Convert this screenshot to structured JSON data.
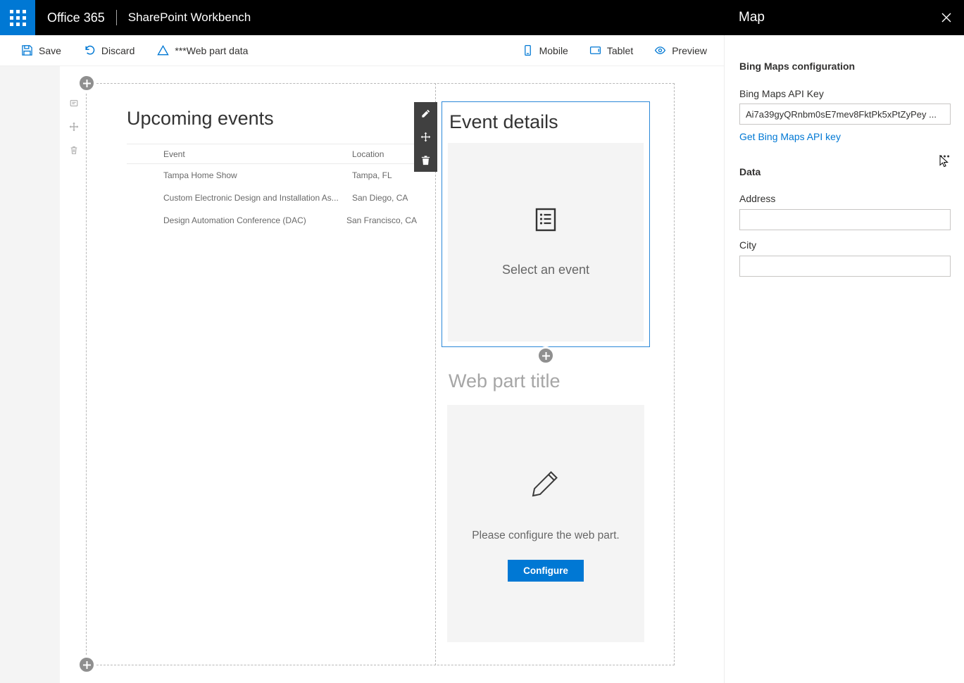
{
  "header": {
    "brand": "Office 365",
    "product": "SharePoint Workbench"
  },
  "toolbar": {
    "save": "Save",
    "discard": "Discard",
    "webpart_data": "***Web part data",
    "mobile": "Mobile",
    "tablet": "Tablet",
    "preview": "Preview"
  },
  "canvas": {
    "upcoming_events": {
      "title": "Upcoming events",
      "columns": [
        "Event",
        "Location"
      ],
      "rows": [
        [
          "Tampa Home Show",
          "Tampa, FL"
        ],
        [
          "Custom Electronic Design and Installation As...",
          "San Diego, CA"
        ],
        [
          "Design Automation Conference (DAC)",
          "San Francisco, CA"
        ]
      ]
    },
    "event_details": {
      "title": "Event details",
      "placeholder": "Select an event"
    },
    "configure_part": {
      "title": "Web part title",
      "message": "Please configure the web part.",
      "button": "Configure"
    }
  },
  "panel": {
    "title": "Map",
    "section_maps": "Bing Maps configuration",
    "api_key_label": "Bing Maps API Key",
    "api_key_value": "Ai7a39gyQRnbm0sE7mev8FktPk5xPtZyPey ...",
    "api_key_link": "Get Bing Maps API key",
    "section_data": "Data",
    "address_label": "Address",
    "address_value": "",
    "city_label": "City",
    "city_value": ""
  },
  "colors": {
    "accent": "#0078d4",
    "selection_border": "#2b88d8",
    "header_bg": "#000000",
    "placeholder_bg": "#f4f4f4"
  }
}
